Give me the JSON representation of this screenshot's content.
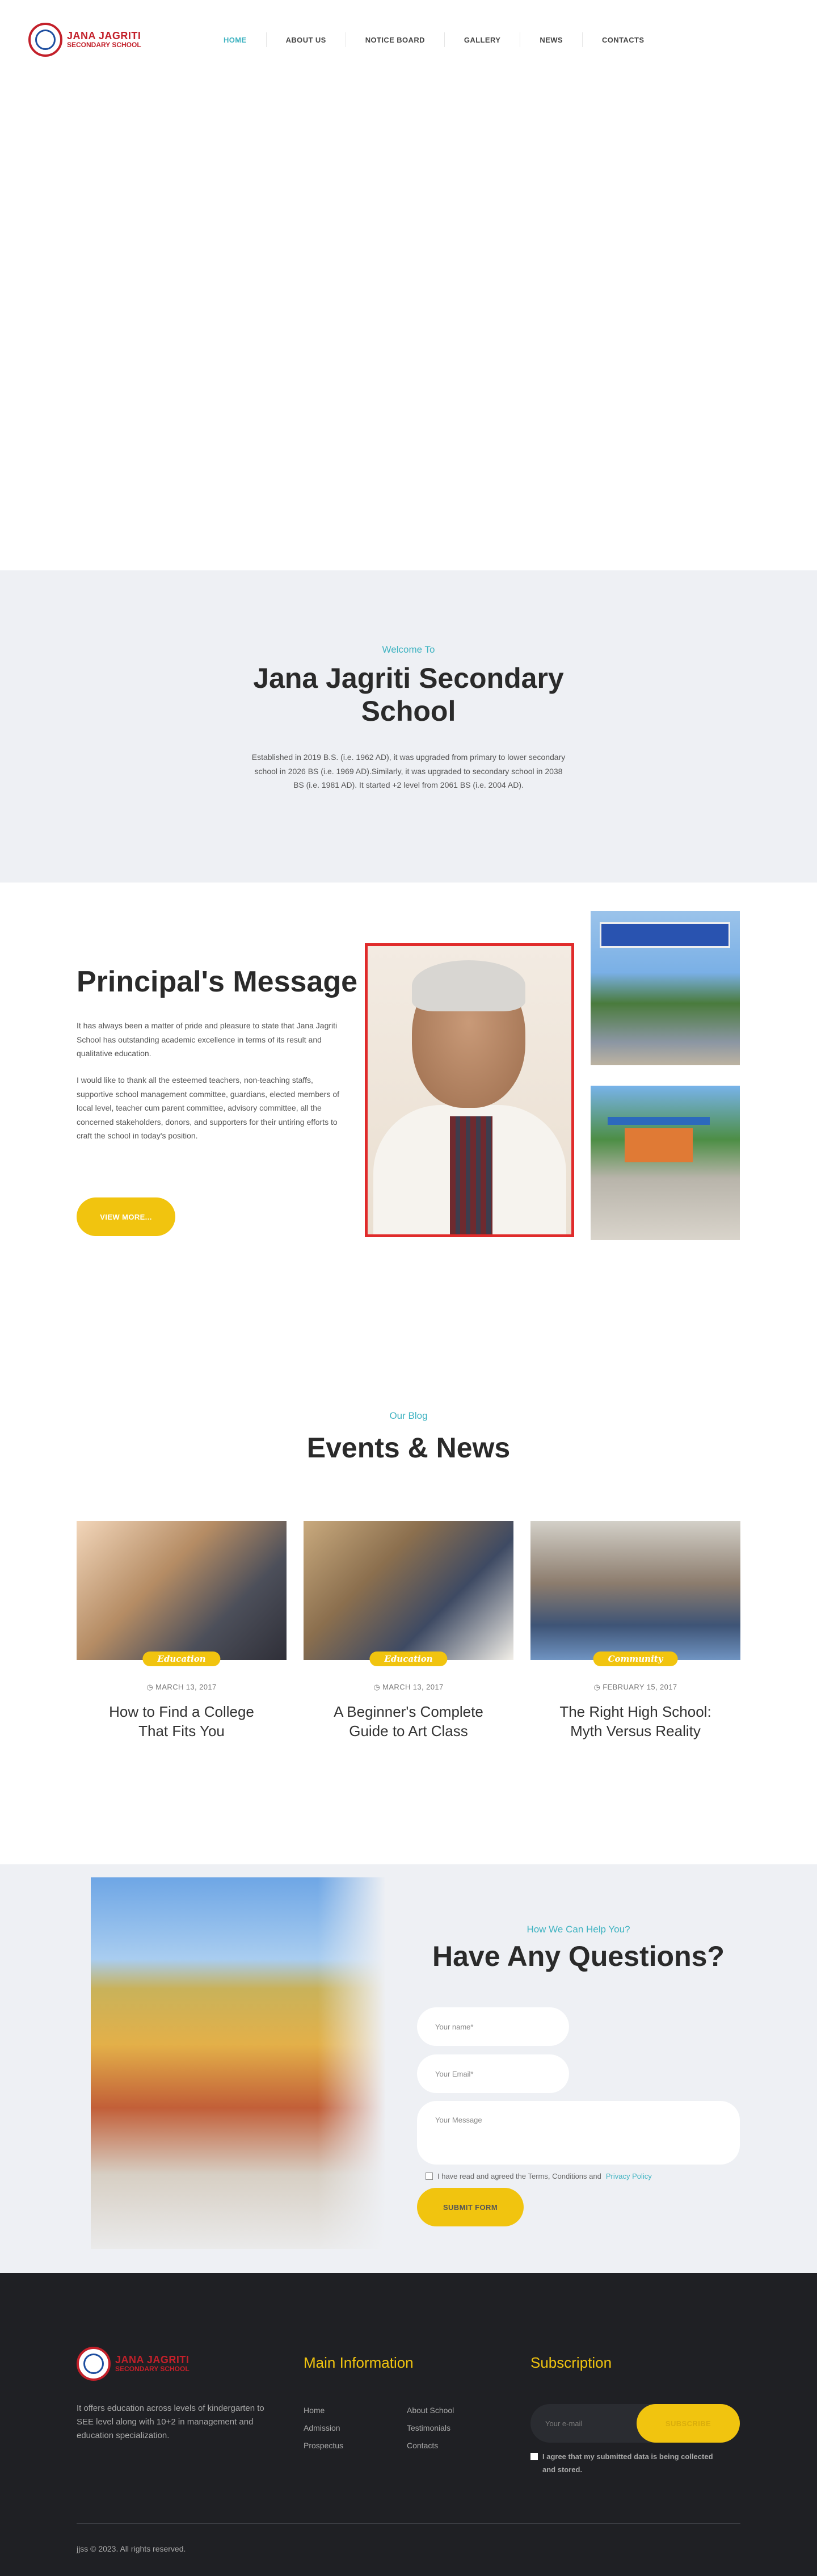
{
  "header": {
    "logo_line1": "JANA JAGRITI",
    "logo_line2": "SECONDARY SCHOOL",
    "nav": [
      "HOME",
      "ABOUT US",
      "NOTICE BOARD",
      "GALLERY",
      "NEWS",
      "CONTACTS"
    ],
    "active_nav": "HOME",
    "accent_color": "#3fb3c1"
  },
  "welcome": {
    "kicker": "Welcome To",
    "title": "Jana Jagriti Secondary School",
    "text": "Established in 2019 B.S. (i.e. 1962 AD), it was upgraded from primary to lower secondary school in 2026 BS (i.e. 1969 AD).Similarly, it was upgraded to secondary school in 2038 BS (i.e. 1981 AD). It started +2 level from 2061 BS (i.e. 2004 AD)."
  },
  "principal": {
    "title": "Principal's Message",
    "para1": "It has always been a matter of pride and pleasure to state that Jana Jagriti School has outstanding academic excellence in terms of its result and qualitative education.",
    "para2": "I would like to thank all the esteemed teachers, non-teaching staffs, supportive school management committee, guardians, elected members of local level, teacher cum parent committee, advisory committee, all the concerned stakeholders, donors, and supporters for their untiring efforts to craft the school in today's position.",
    "button": "VIEW MORE..."
  },
  "events": {
    "kicker": "Our Blog",
    "title": "Events & News",
    "cards": [
      {
        "tag": "Education",
        "date": "MARCH 13, 2017",
        "title": "How to Find a College That Fits You"
      },
      {
        "tag": "Education",
        "date": "MARCH 13, 2017",
        "title": "A Beginner's Complete Guide to Art Class"
      },
      {
        "tag": "Community",
        "date": "FEBRUARY 15, 2017",
        "title": "The Right High School: Myth Versus Reality"
      }
    ]
  },
  "contact": {
    "kicker": "How We Can Help You?",
    "title": "Have Any Questions?",
    "name_placeholder": "Your name*",
    "email_placeholder": "Your Email*",
    "message_placeholder": "Your Message",
    "agree_text": "I have read and agreed the Terms, Conditions and",
    "agree_link": "Privacy Policy",
    "submit": "SUBMIT FORM"
  },
  "footer": {
    "about": "It offers education across levels of kindergarten to SEE level along with 10+2 in management and education specialization.",
    "main_info_title": "Main Information",
    "links": [
      "Home",
      "About School",
      "Admission",
      "Testimonials",
      "Prospectus",
      "Contacts"
    ],
    "subscription_title": "Subscription",
    "email_placeholder": "Your e-mail",
    "subscribe_button": "SUBSCRIBE",
    "consent": "I agree that my submitted data is being collected and stored.",
    "copyright": "jjss © 2023. All rights reserved.",
    "brand_yellow": "#f1c40f"
  }
}
